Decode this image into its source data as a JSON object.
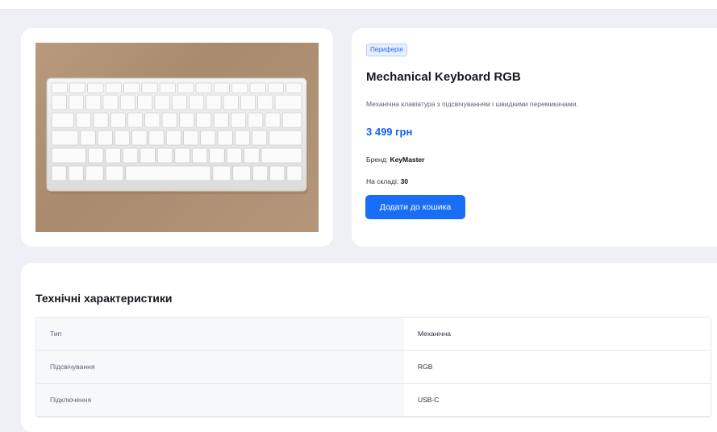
{
  "product": {
    "category": "Периферія",
    "name": "Mechanical Keyboard RGB",
    "description": "Механічна клавіатура з підсвічуванням і швидкими перемикачами.",
    "price": "3 499 грн",
    "brand_label": "Бренд:",
    "brand": "KeyMaster",
    "stock_label": "На складі:",
    "stock": "30",
    "add_to_cart": "Додати до кошика",
    "image_alt": "keyboard-photo"
  },
  "specs": {
    "title": "Технічні характеристики",
    "rows": [
      {
        "key": "Тип",
        "value": "Механічна"
      },
      {
        "key": "Підсвічування",
        "value": "RGB"
      },
      {
        "key": "Підключення",
        "value": "USB-C"
      }
    ]
  },
  "colors": {
    "accent": "#1a6ef5",
    "price": "#1462f0",
    "background": "#eef0f5"
  }
}
